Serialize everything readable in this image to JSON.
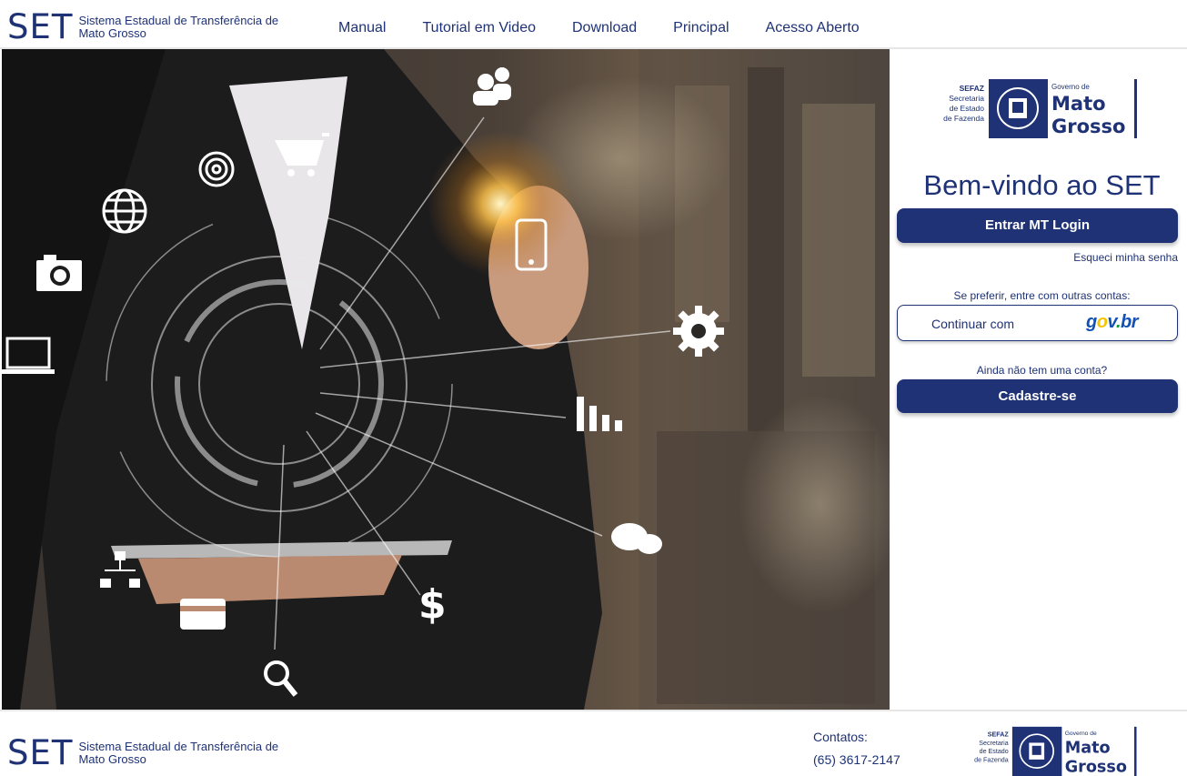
{
  "header": {
    "brand_logo": "SET",
    "brand_text": "Sistema Estadual de Transferência de Mato Grosso",
    "nav": [
      "Manual",
      "Tutorial em Video",
      "Download",
      "Principal",
      "Acesso Aberto"
    ]
  },
  "sefaz_logo": {
    "line1": "SEFAZ",
    "line2": "Secretaria",
    "line3": "de Estado",
    "line4": "de Fazenda",
    "gov_small": "Governo de",
    "gov_big1": "Mato",
    "gov_big2": "Grosso"
  },
  "login": {
    "welcome": "Bem-vindo ao SET",
    "login_button": "Entrar MT Login",
    "forgot_password": "Esqueci minha senha",
    "prefer_text": "Se preferir, entre com outras contas:",
    "govbr_label": "Continuar com",
    "no_account": "Ainda não tem uma conta?",
    "signup_button": "Cadastre-se"
  },
  "footer": {
    "brand_logo": "SET",
    "brand_text": "Sistema Estadual de Transferência de Mato Grosso",
    "contacts_label": "Contatos:",
    "phone": "(65) 3617-2147"
  },
  "colors": {
    "brand_navy": "#1e3275",
    "govbr_blue": "#1351b4",
    "govbr_yellow": "#f5c400",
    "govbr_green": "#0c9b3f"
  },
  "hero": {
    "icons": [
      "users-icon",
      "shopping-cart-icon",
      "fingerprint-icon",
      "globe-icon",
      "camera-icon",
      "laptop-icon",
      "smartphone-icon",
      "gear-icon",
      "bar-chart-icon",
      "chat-icon",
      "dollar-icon",
      "card-icon",
      "network-icon",
      "search-icon"
    ]
  }
}
